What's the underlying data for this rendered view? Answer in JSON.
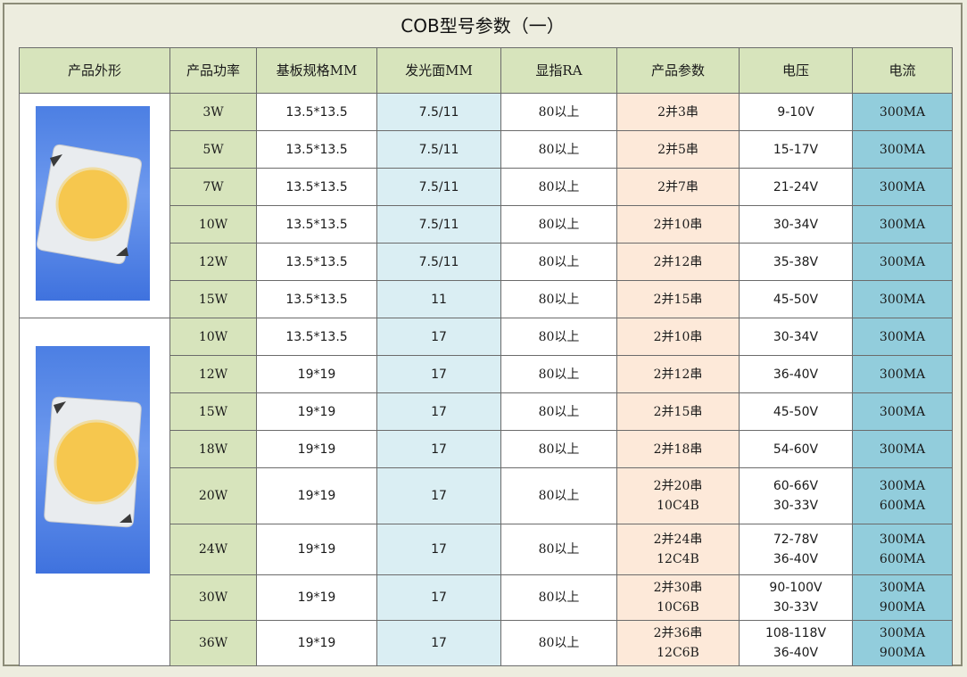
{
  "title": "COB型号参数（一）",
  "headers": [
    "产品外形",
    "产品功率",
    "基板规格MM",
    "发光面MM",
    "显指RA",
    "产品参数",
    "电压",
    "电流"
  ],
  "colors": {
    "header_bg": "#d7e4bc",
    "power_bg": "#d7e4bc",
    "emit_bg": "#daeef3",
    "param_bg": "#fde9d9",
    "current_bg": "#92cddc",
    "photo_bg": "#4c7fe3",
    "phosphor": "#f6c74e"
  },
  "rows": [
    {
      "power": "3W",
      "substrate": "13.5*13.5",
      "emit": "7.5/11",
      "ra": "80以上",
      "param": [
        "2并3串"
      ],
      "voltage": [
        "9-10V"
      ],
      "current": [
        "300MA"
      ]
    },
    {
      "power": "5W",
      "substrate": "13.5*13.5",
      "emit": "7.5/11",
      "ra": "80以上",
      "param": [
        "2并5串"
      ],
      "voltage": [
        "15-17V"
      ],
      "current": [
        "300MA"
      ]
    },
    {
      "power": "7W",
      "substrate": "13.5*13.5",
      "emit": "7.5/11",
      "ra": "80以上",
      "param": [
        "2并7串"
      ],
      "voltage": [
        "21-24V"
      ],
      "current": [
        "300MA"
      ]
    },
    {
      "power": "10W",
      "substrate": "13.5*13.5",
      "emit": "7.5/11",
      "ra": "80以上",
      "param": [
        "2并10串"
      ],
      "voltage": [
        "30-34V"
      ],
      "current": [
        "300MA"
      ]
    },
    {
      "power": "12W",
      "substrate": "13.5*13.5",
      "emit": "7.5/11",
      "ra": "80以上",
      "param": [
        "2并12串"
      ],
      "voltage": [
        "35-38V"
      ],
      "current": [
        "300MA"
      ]
    },
    {
      "power": "15W",
      "substrate": "13.5*13.5",
      "emit": "11",
      "ra": "80以上",
      "param": [
        "2并15串"
      ],
      "voltage": [
        "45-50V"
      ],
      "current": [
        "300MA"
      ]
    },
    {
      "power": "10W",
      "substrate": "13.5*13.5",
      "emit": "17",
      "ra": "80以上",
      "param": [
        "2并10串"
      ],
      "voltage": [
        "30-34V"
      ],
      "current": [
        "300MA"
      ]
    },
    {
      "power": "12W",
      "substrate": "19*19",
      "emit": "17",
      "ra": "80以上",
      "param": [
        "2并12串"
      ],
      "voltage": [
        "36-40V"
      ],
      "current": [
        "300MA"
      ]
    },
    {
      "power": "15W",
      "substrate": "19*19",
      "emit": "17",
      "ra": "80以上",
      "param": [
        "2并15串"
      ],
      "voltage": [
        "45-50V"
      ],
      "current": [
        "300MA"
      ]
    },
    {
      "power": "18W",
      "substrate": "19*19",
      "emit": "17",
      "ra": "80以上",
      "param": [
        "2并18串"
      ],
      "voltage": [
        "54-60V"
      ],
      "current": [
        "300MA"
      ]
    },
    {
      "power": "20W",
      "substrate": "19*19",
      "emit": "17",
      "ra": "80以上",
      "param": [
        "2并20串",
        "10C4B"
      ],
      "voltage": [
        "60-66V",
        "30-33V"
      ],
      "current": [
        "300MA",
        "600MA"
      ]
    },
    {
      "power": "24W",
      "substrate": "19*19",
      "emit": "17",
      "ra": "80以上",
      "param": [
        "2并24串",
        "12C4B"
      ],
      "voltage": [
        "72-78V",
        "36-40V"
      ],
      "current": [
        "300MA",
        "600MA"
      ]
    },
    {
      "power": "30W",
      "substrate": "19*19",
      "emit": "17",
      "ra": "80以上",
      "param": [
        "2并30串",
        "10C6B"
      ],
      "voltage": [
        "90-100V",
        "30-33V"
      ],
      "current": [
        "300MA",
        "900MA"
      ]
    },
    {
      "power": "36W",
      "substrate": "19*19",
      "emit": "17",
      "ra": "80以上",
      "param": [
        "2并36串",
        "12C6B"
      ],
      "voltage": [
        "108-118V",
        "36-40V"
      ],
      "current": [
        "300MA",
        "900MA"
      ]
    }
  ],
  "images": [
    {
      "name": "cob-chip-13-5-photo",
      "depicts": "small-cob-chip"
    },
    {
      "name": "cob-chip-19-photo",
      "depicts": "large-cob-chip"
    }
  ]
}
